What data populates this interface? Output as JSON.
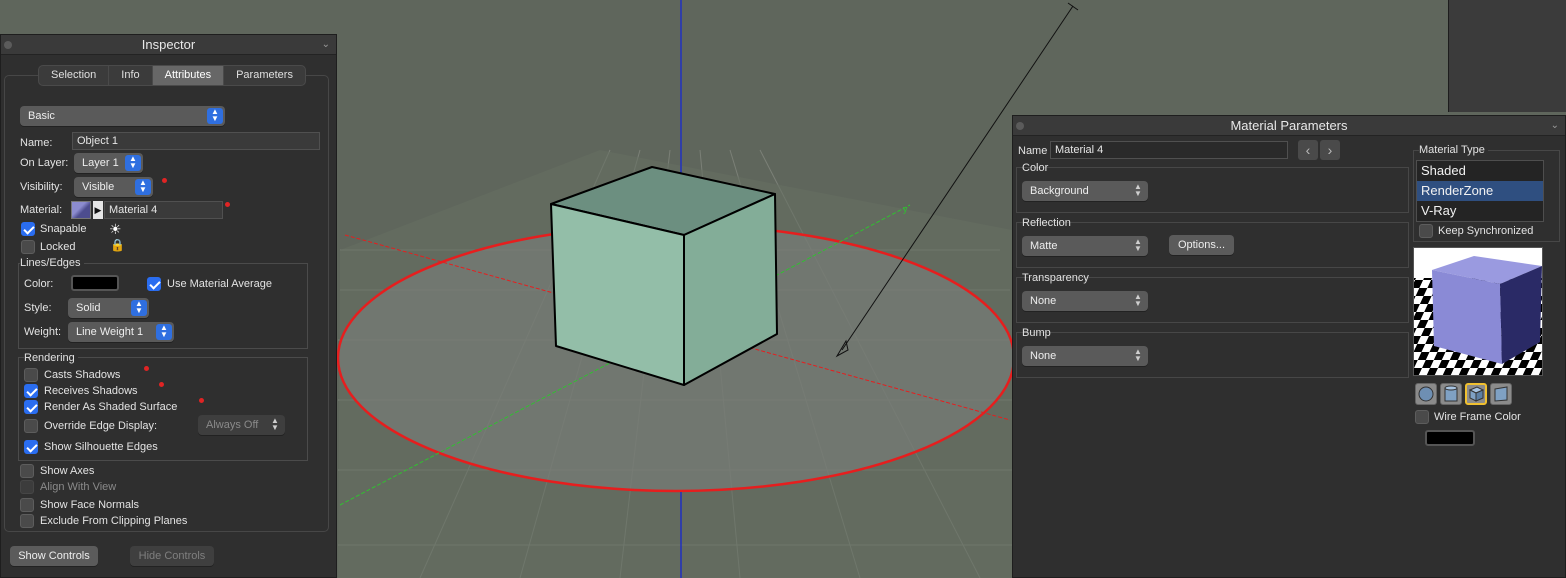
{
  "viewport": {
    "background": "#5f665c",
    "cube_color": "#93bea8",
    "ground_color": "#6f7370",
    "circle_color": "#e61e1e"
  },
  "inspector": {
    "title": "Inspector",
    "tabs": [
      {
        "label": "Selection",
        "active": false
      },
      {
        "label": "Info",
        "active": false
      },
      {
        "label": "Attributes",
        "active": true
      },
      {
        "label": "Parameters",
        "active": false
      }
    ],
    "mode_select": "Basic",
    "name_label": "Name:",
    "name_value": "Object 1",
    "layer_label": "On Layer:",
    "layer_value": "Layer 1",
    "visibility_label": "Visibility:",
    "visibility_value": "Visible",
    "material_label": "Material:",
    "material_value": "Material 4",
    "snapable_label": "Snapable",
    "snapable_checked": true,
    "locked_label": "Locked",
    "locked_checked": false,
    "lines_edges": {
      "title": "Lines/Edges",
      "color_label": "Color:",
      "use_material_average_label": "Use Material Average",
      "use_material_average_checked": true,
      "style_label": "Style:",
      "style_value": "Solid",
      "weight_label": "Weight:",
      "weight_value": "Line Weight 1"
    },
    "rendering": {
      "title": "Rendering",
      "casts_shadows": "Casts Shadows",
      "receives_shadows": "Receives Shadows",
      "render_as_shaded": "Render As Shaded Surface",
      "override_edge_display": "Override Edge Display:",
      "override_edge_value": "Always Off",
      "show_silhouette": "Show Silhouette Edges"
    },
    "show_axes": "Show Axes",
    "align_with_view": "Align With View",
    "show_face_normals": "Show Face Normals",
    "exclude_clipping": "Exclude From Clipping Planes",
    "show_controls": "Show Controls",
    "hide_controls": "Hide Controls"
  },
  "material_params": {
    "title": "Material Parameters",
    "name_label": "Name",
    "name_value": "Material 4",
    "color": {
      "title": "Color",
      "value": "Background"
    },
    "reflection": {
      "title": "Reflection",
      "value": "Matte",
      "options_button": "Options..."
    },
    "transparency": {
      "title": "Transparency",
      "value": "None"
    },
    "bump": {
      "title": "Bump",
      "value": "None"
    },
    "material_type": {
      "title": "Material Type",
      "items": [
        "Shaded",
        "RenderZone",
        "V-Ray"
      ],
      "selected": "RenderZone"
    },
    "keep_synchronized": "Keep Synchronized",
    "wire_frame_color": "Wire Frame Color",
    "preview_cube_color": "#8a8ad6"
  }
}
